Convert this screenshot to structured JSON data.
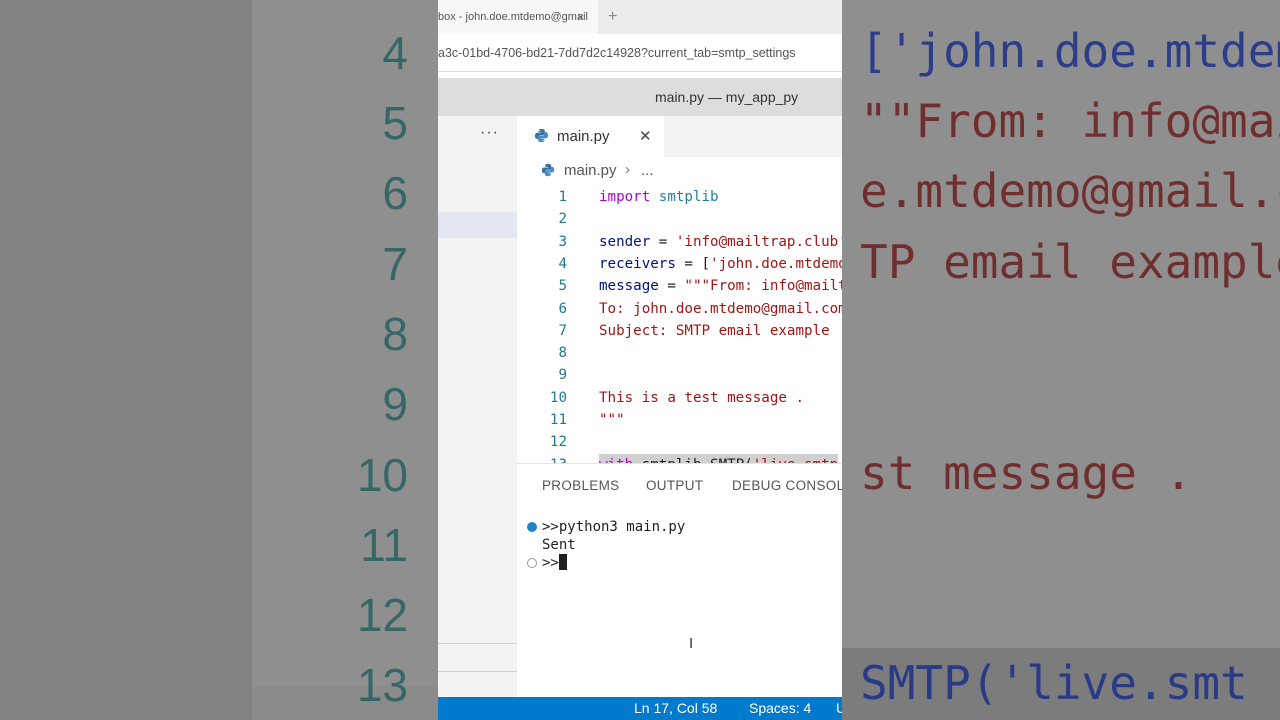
{
  "browser": {
    "tab_title": "box - john.doe.mtdemo@gmail",
    "tab_close": "×",
    "new_tab": "+",
    "url": "a3c-01bd-4706-bd21-7dd7d2c14928?current_tab=smtp_settings"
  },
  "window": {
    "title": "main.py — my_app_py"
  },
  "sidebar": {
    "more": "···"
  },
  "editor": {
    "tab": {
      "label": "main.py",
      "close": "✕"
    },
    "breadcrumb": {
      "file": "main.py",
      "separator": "›",
      "more": "..."
    },
    "lines": [
      {
        "n": "1",
        "parts": [
          [
            "kw",
            "import"
          ],
          [
            "",
            ""
          ],
          [
            "mod",
            " smtplib"
          ]
        ]
      },
      {
        "n": "2",
        "parts": []
      },
      {
        "n": "3",
        "parts": [
          [
            "var",
            "sender"
          ],
          [
            "",
            " = "
          ],
          [
            "str",
            "'info@mailtrap.club'"
          ]
        ]
      },
      {
        "n": "4",
        "parts": [
          [
            "var",
            "receivers"
          ],
          [
            "",
            " = ["
          ],
          [
            "str",
            "'john.doe.mtdemo@gmail.com'"
          ],
          [
            "",
            "]"
          ]
        ]
      },
      {
        "n": "5",
        "parts": [
          [
            "var",
            "message"
          ],
          [
            "",
            " = "
          ],
          [
            "str",
            "\"\"\"From: info@mailtrap.club"
          ]
        ]
      },
      {
        "n": "6",
        "parts": [
          [
            "str",
            "To: john.doe.mtdemo@gmail.com"
          ]
        ]
      },
      {
        "n": "7",
        "parts": [
          [
            "str",
            "Subject: SMTP email example"
          ]
        ]
      },
      {
        "n": "8",
        "parts": []
      },
      {
        "n": "9",
        "parts": []
      },
      {
        "n": "10",
        "parts": [
          [
            "str",
            "This is a test message ."
          ]
        ]
      },
      {
        "n": "11",
        "parts": [
          [
            "str",
            "\"\"\""
          ]
        ]
      },
      {
        "n": "12",
        "parts": []
      },
      {
        "n": "13",
        "parts": [
          [
            "kw",
            "with"
          ],
          [
            "",
            " smtplib.SMTP("
          ],
          [
            "str",
            "'live.smtp"
          ]
        ]
      }
    ]
  },
  "panel": {
    "tabs": [
      "PROBLEMS",
      "OUTPUT",
      "DEBUG CONSOLE"
    ],
    "terminal": {
      "command": ">>python3 main.py",
      "output": "Sent",
      "prompt": ">>"
    },
    "ibeam": "I"
  },
  "status": {
    "position": "Ln 17, Col 58",
    "spaces": "Spaces: 4",
    "trailing": "U"
  },
  "background": {
    "left_numbers": [
      "4",
      "5",
      "6",
      "7",
      "8",
      "9",
      "10",
      "11",
      "12",
      "13"
    ],
    "right_lines": [
      "['john.doe.mtdem",
      "\"\"From: info@mai",
      "e.mtdemo@gmail.co",
      "TP email example",
      "st message .",
      "SMTP('live.smt"
    ]
  },
  "colors": {
    "accent": "#007acc",
    "keyword": "#af00db",
    "module": "#267f99",
    "variable": "#001080",
    "string": "#a31515",
    "line_number": "#237893"
  }
}
